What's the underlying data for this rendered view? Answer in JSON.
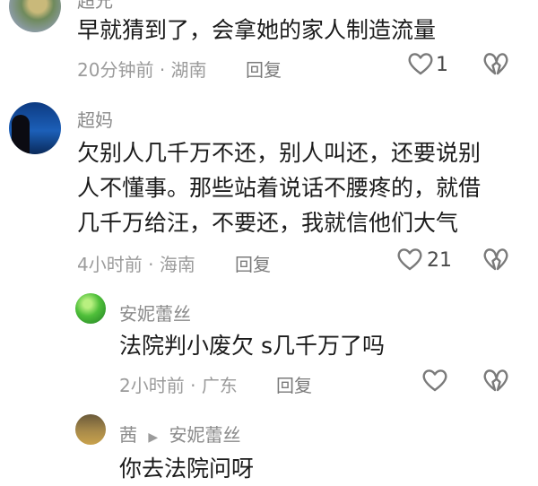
{
  "comments": [
    {
      "name": "超兄",
      "text_lines": [
        "早就猜到了，会拿她的家人制造流量"
      ],
      "time": "20分钟前",
      "region": "湖南",
      "reply_label": "回复",
      "likes": "1"
    },
    {
      "name": "超妈",
      "text_lines": [
        "欠别人几千万不还，别人叫还，还要说别",
        "人不懂事。那些站着说话不腰疼的，就借",
        "几千万给汪，不要还，我就信他们大气"
      ],
      "time": "4小时前",
      "region": "海南",
      "reply_label": "回复",
      "likes": "21"
    }
  ],
  "replies": [
    {
      "name": "安妮蕾丝",
      "text": "法院判小废欠 s几千万了吗",
      "time": "2小时前",
      "region": "广东",
      "reply_label": "回复",
      "likes": ""
    },
    {
      "name": "茜",
      "reply_to": "安妮蕾丝",
      "text": "你去法院问呀"
    }
  ],
  "separator": "·",
  "icons": {
    "like": "heart-outline-icon",
    "dislike": "broken-heart-icon",
    "reply_arrow": "triangle-right-icon"
  },
  "colors": {
    "text": "#1b1b1b",
    "secondary": "#9b9b9b",
    "icon": "#7a7a7a"
  }
}
